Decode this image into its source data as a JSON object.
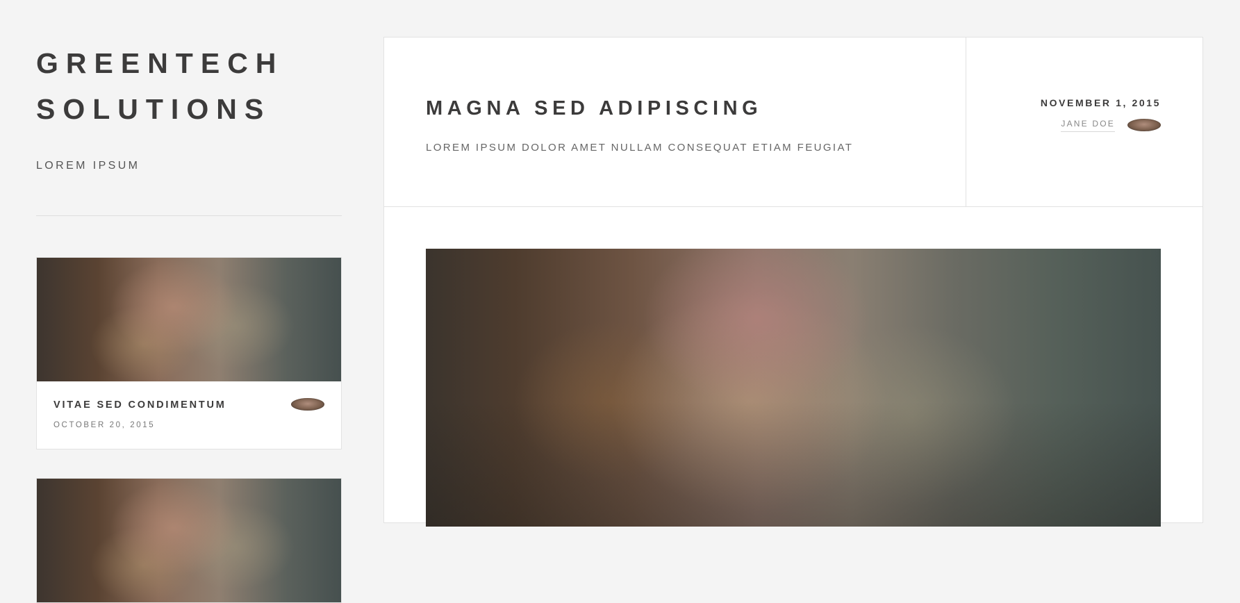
{
  "site": {
    "title": "GREENTECH\nSOLUTIONS",
    "tagline": "LOREM IPSUM"
  },
  "sidebar": {
    "mini_posts": [
      {
        "title": "VITAE SED CONDIMENTUM",
        "date": "OCTOBER 20, 2015"
      }
    ]
  },
  "post": {
    "title": "MAGNA SED ADIPISCING",
    "subtitle": "LOREM IPSUM DOLOR AMET NULLAM CONSEQUAT ETIAM FEUGIAT",
    "date": "NOVEMBER 1, 2015",
    "author": "JANE DOE"
  }
}
